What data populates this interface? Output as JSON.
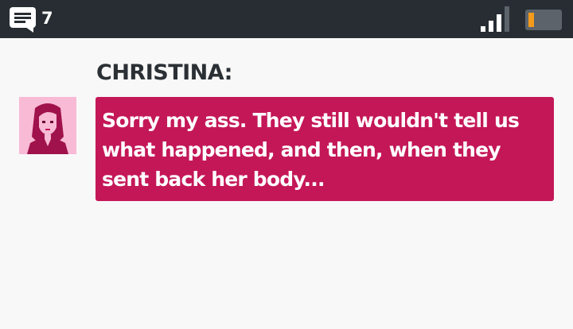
{
  "status_bar": {
    "message_count": "7",
    "icons": {
      "messages": "chat-bubble-icon",
      "signal": "signal-strength-icon",
      "battery": "battery-low-icon"
    },
    "colors": {
      "background": "#272d33",
      "battery_level": "#f49b1c"
    },
    "signal_bars_active": 3,
    "signal_bars_total": 4
  },
  "conversation": {
    "speaker": "CHRISTINA:",
    "message": "Sorry my ass. They still wouldn't tell us what happened, and then, when they sent back her body...",
    "colors": {
      "bubble": "#c41758",
      "avatar_background": "#f8bad5"
    }
  }
}
